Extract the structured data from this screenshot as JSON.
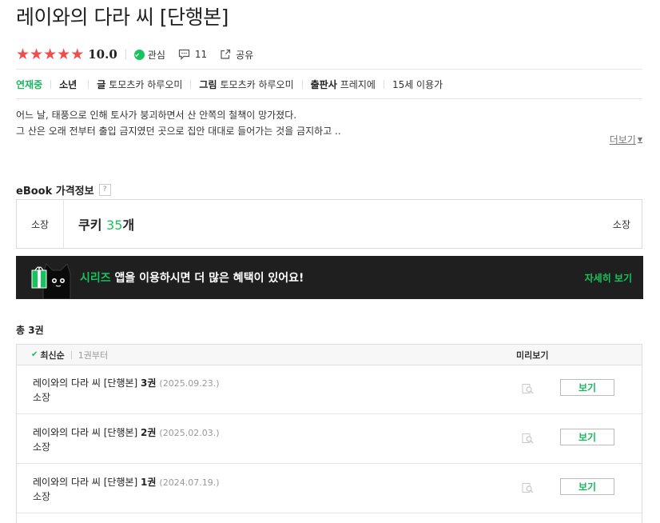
{
  "header": {
    "title": "레이와의 다라 씨 [단행본]"
  },
  "meta": {
    "rating": "10.0",
    "interest_label": "관심",
    "comment_count": "11",
    "share_label": "공유"
  },
  "info": {
    "status": "연재중",
    "genre": "소년",
    "writer_label": "글",
    "writer": "토모츠카 하루오미",
    "artist_label": "그림",
    "artist": "토모츠카 하루오미",
    "publisher_label": "출판사",
    "publisher": "프레지에",
    "age": "15세 이용가"
  },
  "description": {
    "line1": "어느 날, 태풍으로 인해 토사가 붕괴하면서 산 안쪽의 철책이 망가졌다.",
    "line2": "그 산은 오래 전부터 출입 금지였던 곳으로 집안 대대로 들어가는 것을 금지하고 ..",
    "more_label": "더보기"
  },
  "ebook": {
    "section_label": "eBook 가격정보",
    "help_label": "?",
    "own_label": "소장",
    "price_prefix": "쿠키 ",
    "price_value": "35",
    "price_unit": "개",
    "right_label": "소장"
  },
  "banner": {
    "brand": "시리즈",
    "text": " 앱을 이용하시면 더 많은 혜택이 있어요!",
    "detail_label": "자세히 보기"
  },
  "list": {
    "total_label": "총 3권",
    "sort_latest": "최신순",
    "sort_first": "1권부터",
    "preview_label": "미리보기",
    "items": [
      {
        "title": "레이와의 다라 씨 [단행본] ",
        "vol": "3권",
        "date": "(2025.09.23.)",
        "status": "소장",
        "button": "보기"
      },
      {
        "title": "레이와의 다라 씨 [단행본] ",
        "vol": "2권",
        "date": "(2025.02.03.)",
        "status": "소장",
        "button": "보기"
      },
      {
        "title": "레이와의 다라 씨 [단행본] ",
        "vol": "1권",
        "date": "(2024.07.19.)",
        "status": "소장",
        "button": "보기"
      }
    ]
  },
  "colors": {
    "accent": "#17c35c",
    "star": "#f24c4c",
    "banner_bg": "#1f1f1f"
  }
}
